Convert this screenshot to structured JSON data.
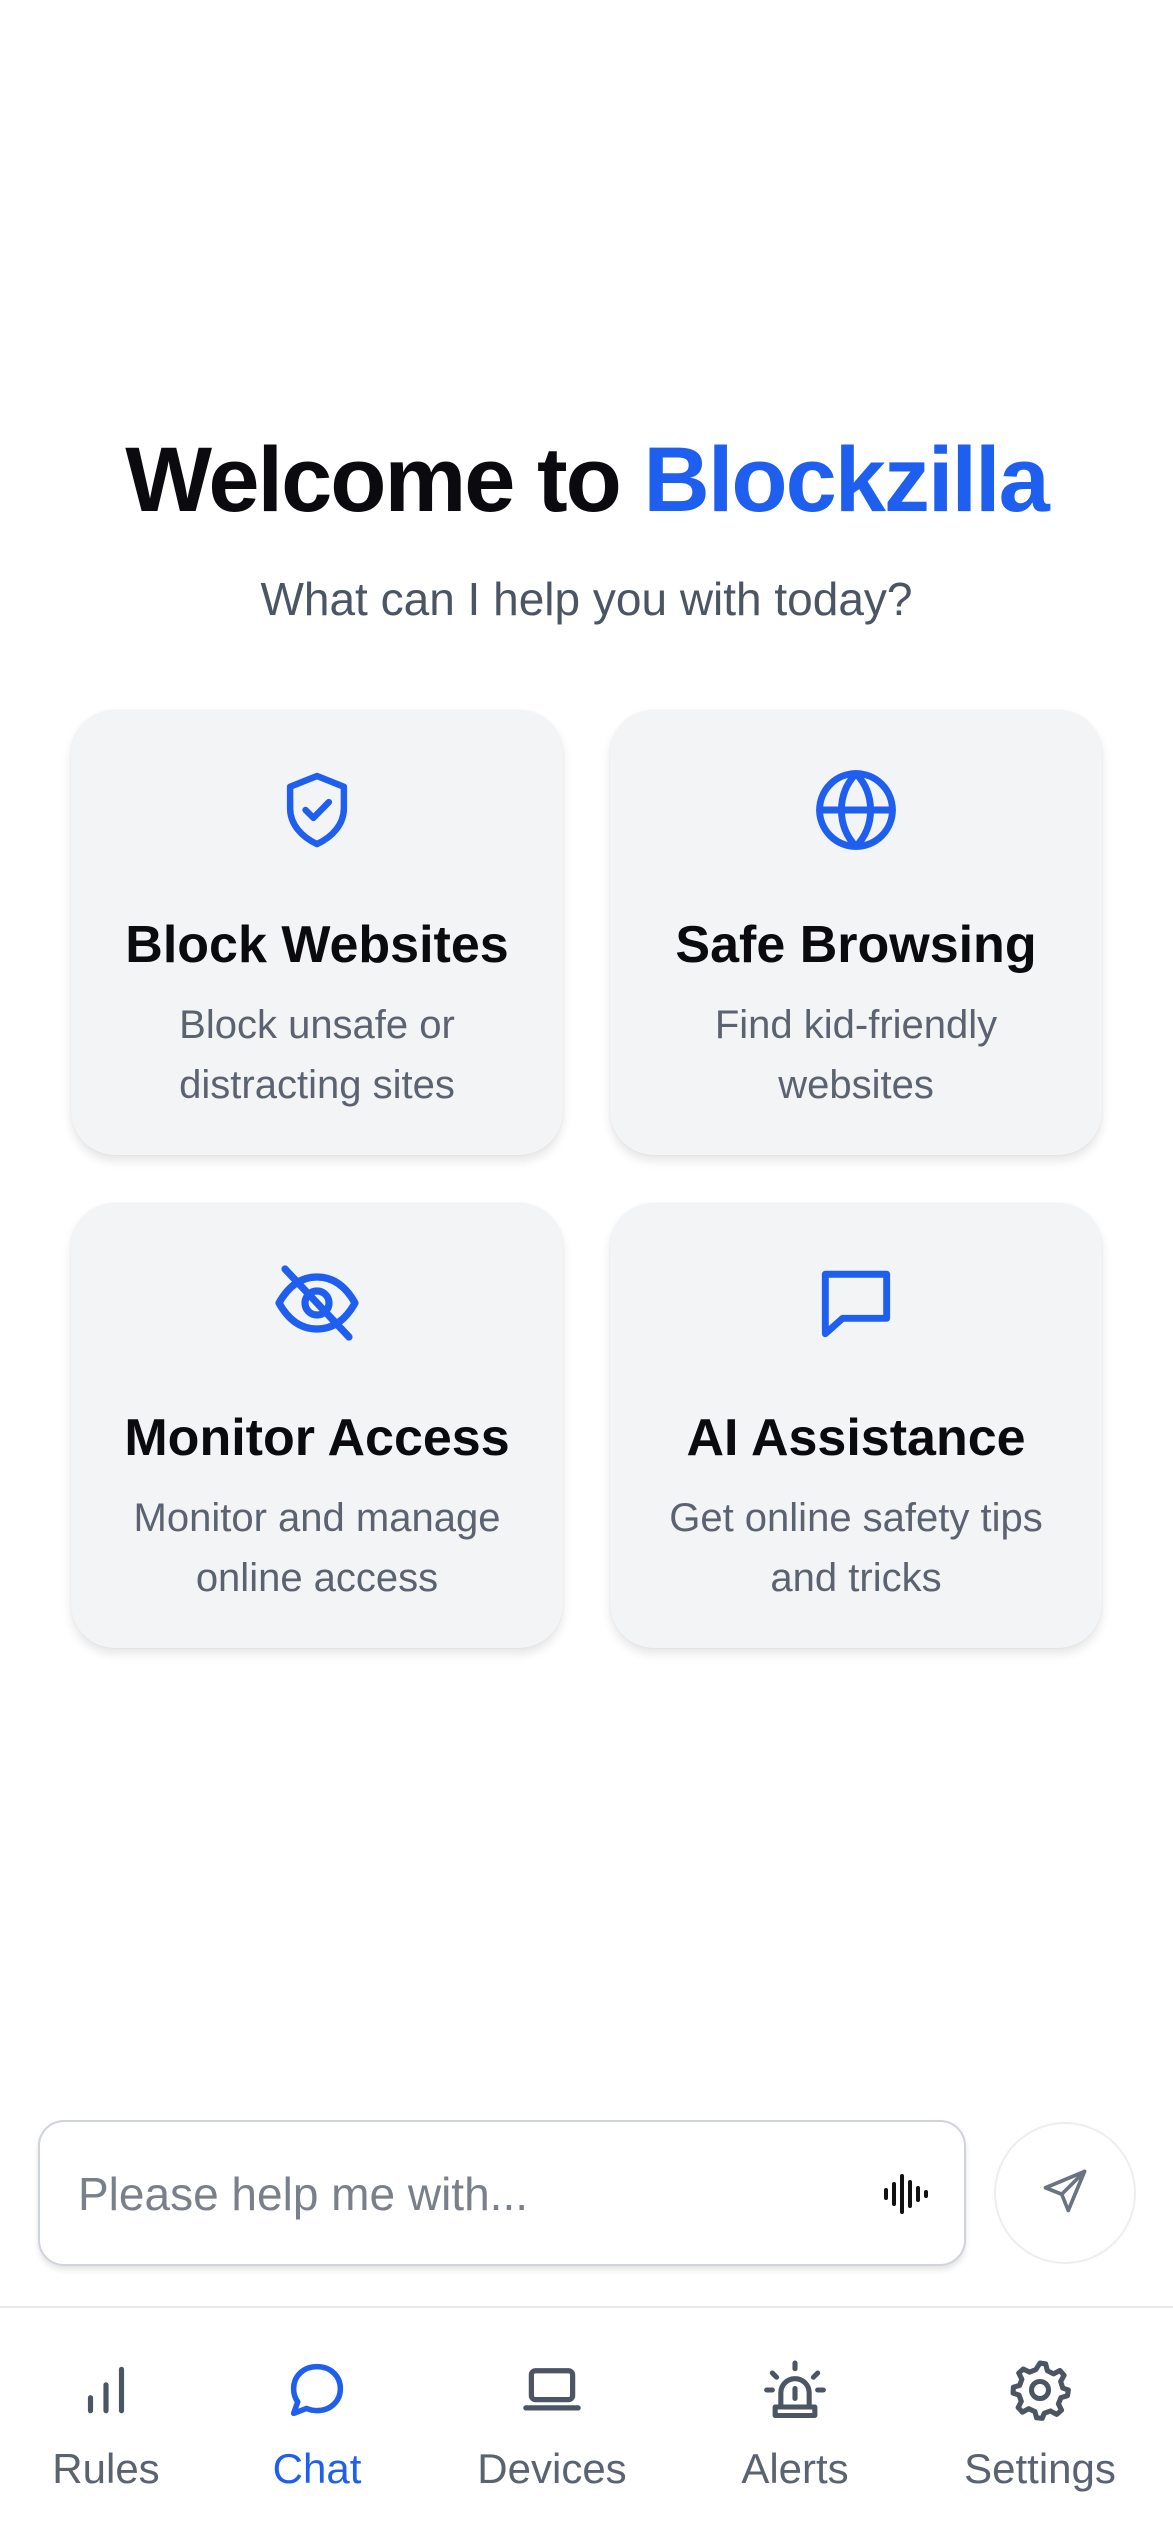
{
  "header": {
    "welcome_prefix": "Welcome to ",
    "brand_name": "Blockzilla",
    "subtitle": "What can I help you with today?"
  },
  "cards": [
    {
      "title": "Block Websites",
      "desc_line1": "Block unsafe or",
      "desc_line2": "distracting sites",
      "icon": "shield-check-icon"
    },
    {
      "title": "Safe Browsing",
      "desc_line1": "Find kid-friendly",
      "desc_line2": "websites",
      "icon": "globe-icon"
    },
    {
      "title": "Monitor Access",
      "desc_line1": "Monitor and manage",
      "desc_line2": "online access",
      "icon": "eye-off-icon"
    },
    {
      "title": "AI Assistance",
      "desc_line1": "Get online safety tips",
      "desc_line2": "and tricks",
      "icon": "message-square-icon"
    }
  ],
  "chat_input": {
    "placeholder": "Please help me with...",
    "value": ""
  },
  "nav": [
    {
      "label": "Rules",
      "icon": "bar-chart-icon",
      "active": false
    },
    {
      "label": "Chat",
      "icon": "chat-bubble-icon",
      "active": true
    },
    {
      "label": "Devices",
      "icon": "laptop-icon",
      "active": false
    },
    {
      "label": "Alerts",
      "icon": "siren-icon",
      "active": false
    },
    {
      "label": "Settings",
      "icon": "gear-icon",
      "active": false
    }
  ],
  "colors": {
    "accent": "#1f5ff0",
    "card_bg": "#f3f4f6",
    "muted_text": "#5b6270"
  }
}
